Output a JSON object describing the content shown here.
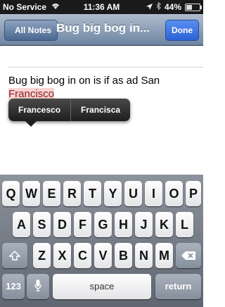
{
  "status_bar": {
    "carrier": "No Service",
    "time": "11:36 AM",
    "battery": "44%",
    "battery_level": 0.44
  },
  "navbar": {
    "back_label": "All Notes",
    "title": "Bug big bog in...",
    "done_label": "Done"
  },
  "note": {
    "text_plain": "Bug big bog in on is if as ad San",
    "text_misspelled": "Francisco"
  },
  "suggestions": [
    "Francesco",
    "Francisca"
  ],
  "keyboard": {
    "row1": [
      "Q",
      "W",
      "E",
      "R",
      "T",
      "Y",
      "U",
      "I",
      "O",
      "P"
    ],
    "row2": [
      "A",
      "S",
      "D",
      "F",
      "G",
      "H",
      "J",
      "K",
      "L"
    ],
    "row3": [
      "Z",
      "X",
      "C",
      "V",
      "B",
      "N",
      "M"
    ],
    "numbers_label": "123",
    "space_label": "space",
    "return_label": "return"
  }
}
